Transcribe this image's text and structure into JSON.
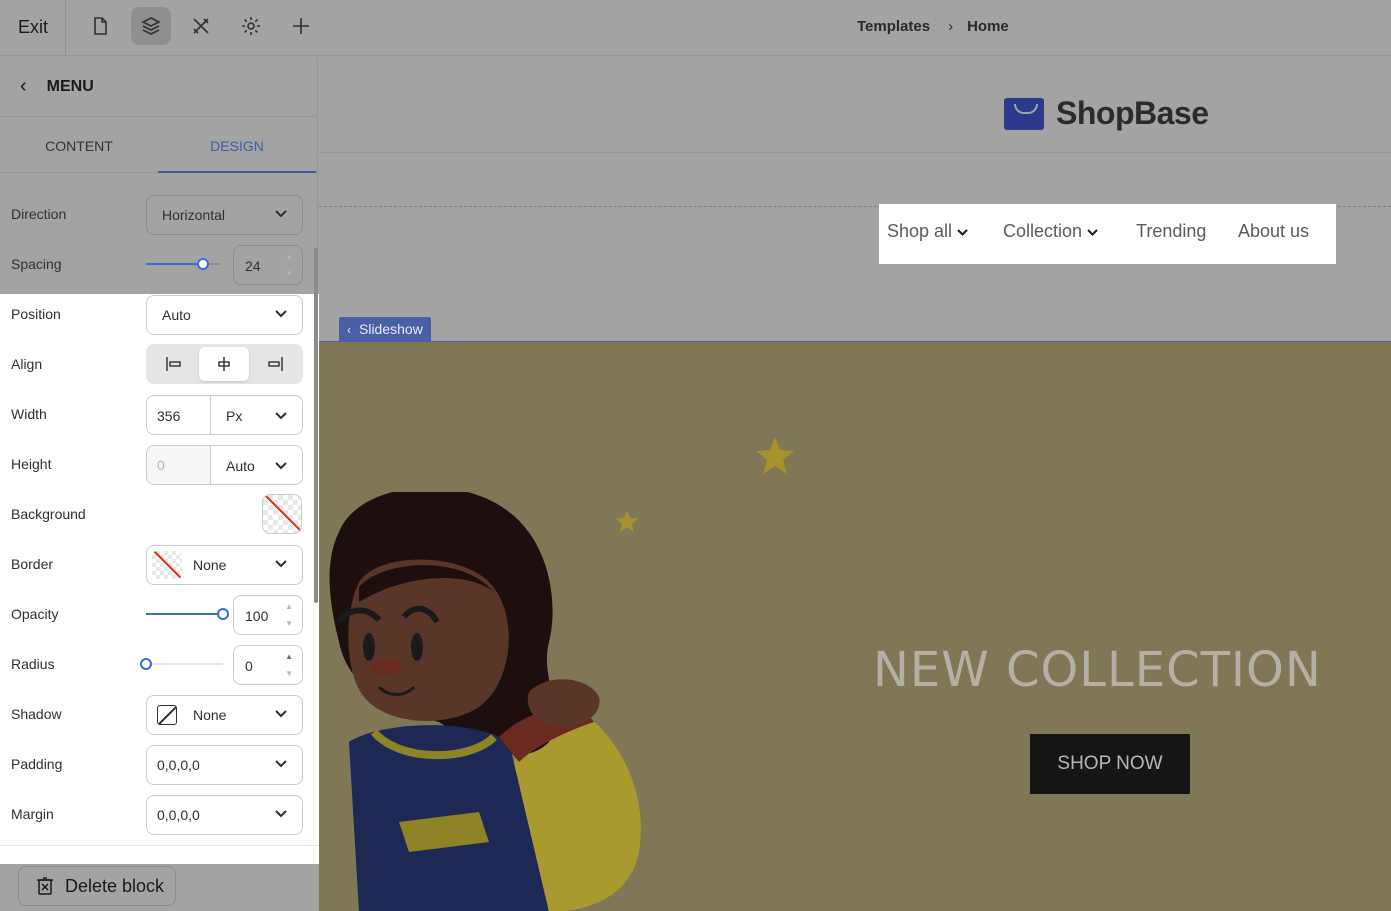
{
  "topbar": {
    "exit_label": "Exit",
    "icons": [
      "page-icon",
      "layers-icon",
      "tools-icon",
      "gear-icon",
      "plus-icon"
    ],
    "breadcrumb": {
      "parent": "Templates",
      "current": "Home"
    }
  },
  "sidebar": {
    "header": {
      "title": "MENU"
    },
    "tabs": [
      {
        "label": "CONTENT"
      },
      {
        "label": "DESIGN",
        "active": true
      }
    ],
    "direction": {
      "label": "Direction",
      "value": "Horizontal"
    },
    "spacing": {
      "label": "Spacing",
      "value": "24",
      "fraction": 0.44
    },
    "position": {
      "label": "Position",
      "value": "Auto"
    },
    "align": {
      "label": "Align",
      "options": [
        "left",
        "center",
        "right"
      ],
      "selected": "center"
    },
    "width": {
      "label": "Width",
      "value": "356",
      "unit": "Px"
    },
    "height": {
      "label": "Height",
      "placeholder": "0",
      "unit": "Auto"
    },
    "background": {
      "label": "Background"
    },
    "border": {
      "label": "Border",
      "value": "None"
    },
    "opacity": {
      "label": "Opacity",
      "value": "100",
      "fraction": 1.0
    },
    "radius": {
      "label": "Radius",
      "value": "0",
      "fraction": 0.0
    },
    "shadow": {
      "label": "Shadow",
      "value": "None"
    },
    "padding": {
      "label": "Padding",
      "value": "0,0,0,0"
    },
    "margin": {
      "label": "Margin",
      "value": "0,0,0,0"
    },
    "delete_label": "Delete block"
  },
  "canvas": {
    "logo_text": "ShopBase",
    "nav": [
      {
        "label": "Shop all",
        "has_dropdown": true
      },
      {
        "label": "Collection",
        "has_dropdown": true
      },
      {
        "label": "Trending",
        "has_dropdown": false
      },
      {
        "label": "About us",
        "has_dropdown": false
      }
    ],
    "slideshow_tag": "Slideshow",
    "hero": {
      "title": "NEW COLLECTION",
      "button_label": "SHOP NOW"
    }
  },
  "colors": {
    "accent": "#3b5aa8",
    "slider": "#3b6bd6",
    "overlay": "#a3a3a3",
    "hero_bg": "#7f7756"
  }
}
